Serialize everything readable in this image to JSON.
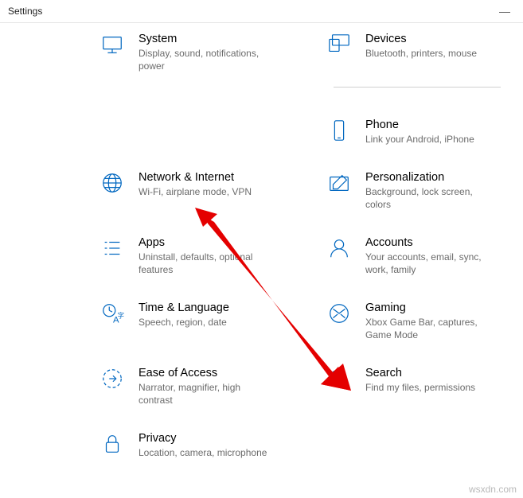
{
  "window": {
    "title": "Settings",
    "minimize": "—"
  },
  "items": [
    {
      "id": "system",
      "title": "System",
      "desc": "Display, sound, notifications, power"
    },
    {
      "id": "devices",
      "title": "Devices",
      "desc": "Bluetooth, printers, mouse"
    },
    {
      "id": "phone",
      "title": "Phone",
      "desc": "Link your Android, iPhone"
    },
    {
      "id": "network",
      "title": "Network & Internet",
      "desc": "Wi-Fi, airplane mode, VPN"
    },
    {
      "id": "personalization",
      "title": "Personalization",
      "desc": "Background, lock screen, colors"
    },
    {
      "id": "apps",
      "title": "Apps",
      "desc": "Uninstall, defaults, optional features"
    },
    {
      "id": "accounts",
      "title": "Accounts",
      "desc": "Your accounts, email, sync, work, family"
    },
    {
      "id": "time",
      "title": "Time & Language",
      "desc": "Speech, region, date"
    },
    {
      "id": "gaming",
      "title": "Gaming",
      "desc": "Xbox Game Bar, captures, Game Mode"
    },
    {
      "id": "ease",
      "title": "Ease of Access",
      "desc": "Narrator, magnifier, high contrast"
    },
    {
      "id": "search",
      "title": "Search",
      "desc": "Find my files, permissions"
    },
    {
      "id": "privacy",
      "title": "Privacy",
      "desc": "Location, camera, microphone"
    }
  ],
  "annotation": {
    "arrow_target": "ease"
  },
  "watermark": "wsxdn.com"
}
